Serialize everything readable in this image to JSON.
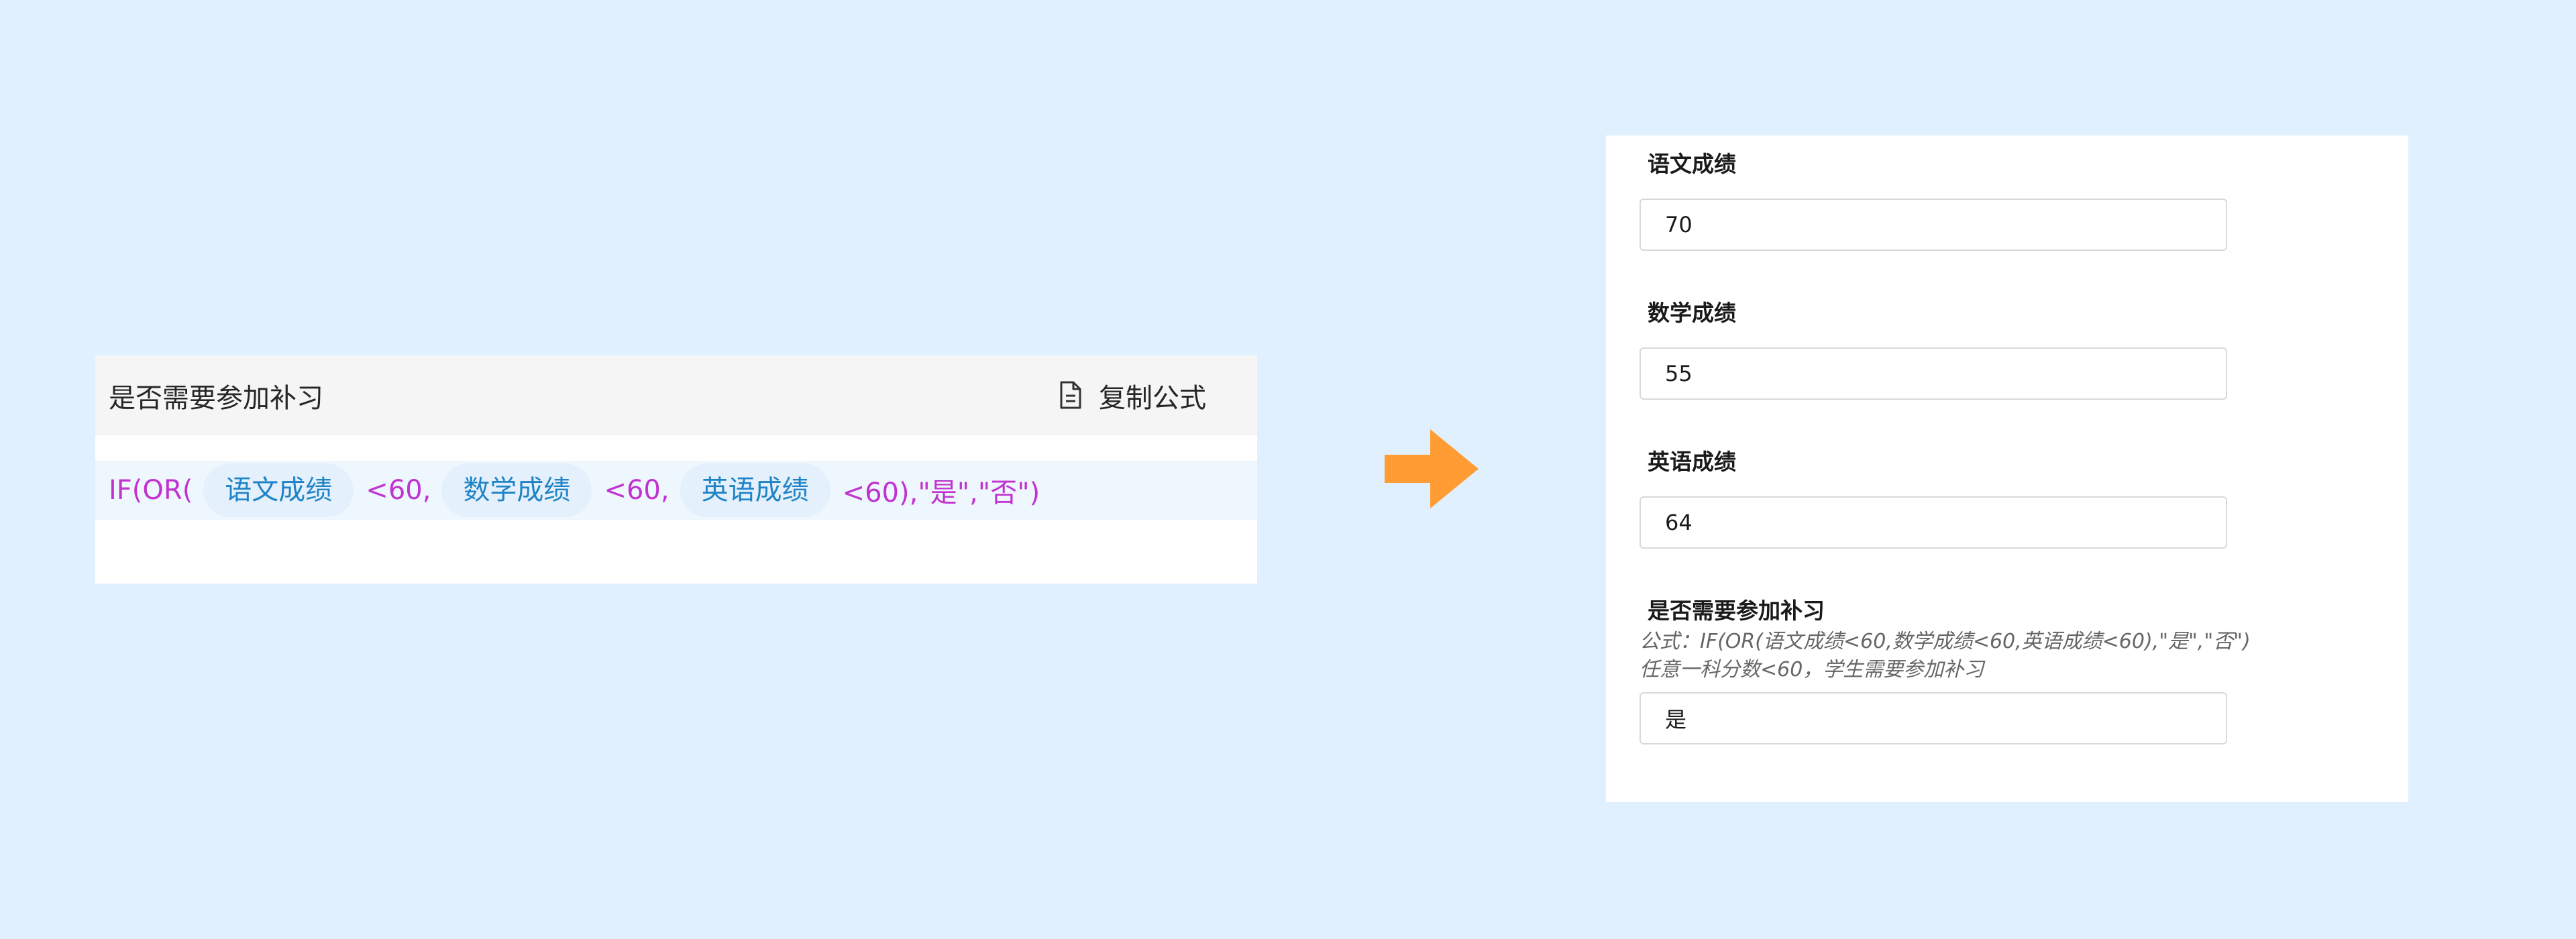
{
  "formula_card": {
    "title": "是否需要参加补习",
    "copy_label": "复制公式",
    "formula": {
      "open": "IF(OR(",
      "fields": [
        "语文成绩",
        "数学成绩",
        "英语成绩"
      ],
      "op1": "<60,",
      "op2": "<60,",
      "tail": "<60),\"是\",\"否\")"
    }
  },
  "form": {
    "fields": [
      {
        "label": "语文成绩",
        "value": "70"
      },
      {
        "label": "数学成绩",
        "value": "55"
      },
      {
        "label": "英语成绩",
        "value": "64"
      },
      {
        "label": "是否需要参加补习",
        "hint_formula": "公式：IF(OR(语文成绩<60,数学成绩<60,英语成绩<60),\"是\",\"否\")",
        "hint_desc": "任意一科分数<60，学生需要参加补习",
        "value": "是"
      }
    ]
  },
  "colors": {
    "background": "#e1f0fe",
    "formula_text": "#c033d0",
    "field_pill_text": "#1f84c7",
    "arrow": "#ff9c33"
  },
  "icons": [
    "copy-document-icon",
    "right-arrow-icon"
  ]
}
